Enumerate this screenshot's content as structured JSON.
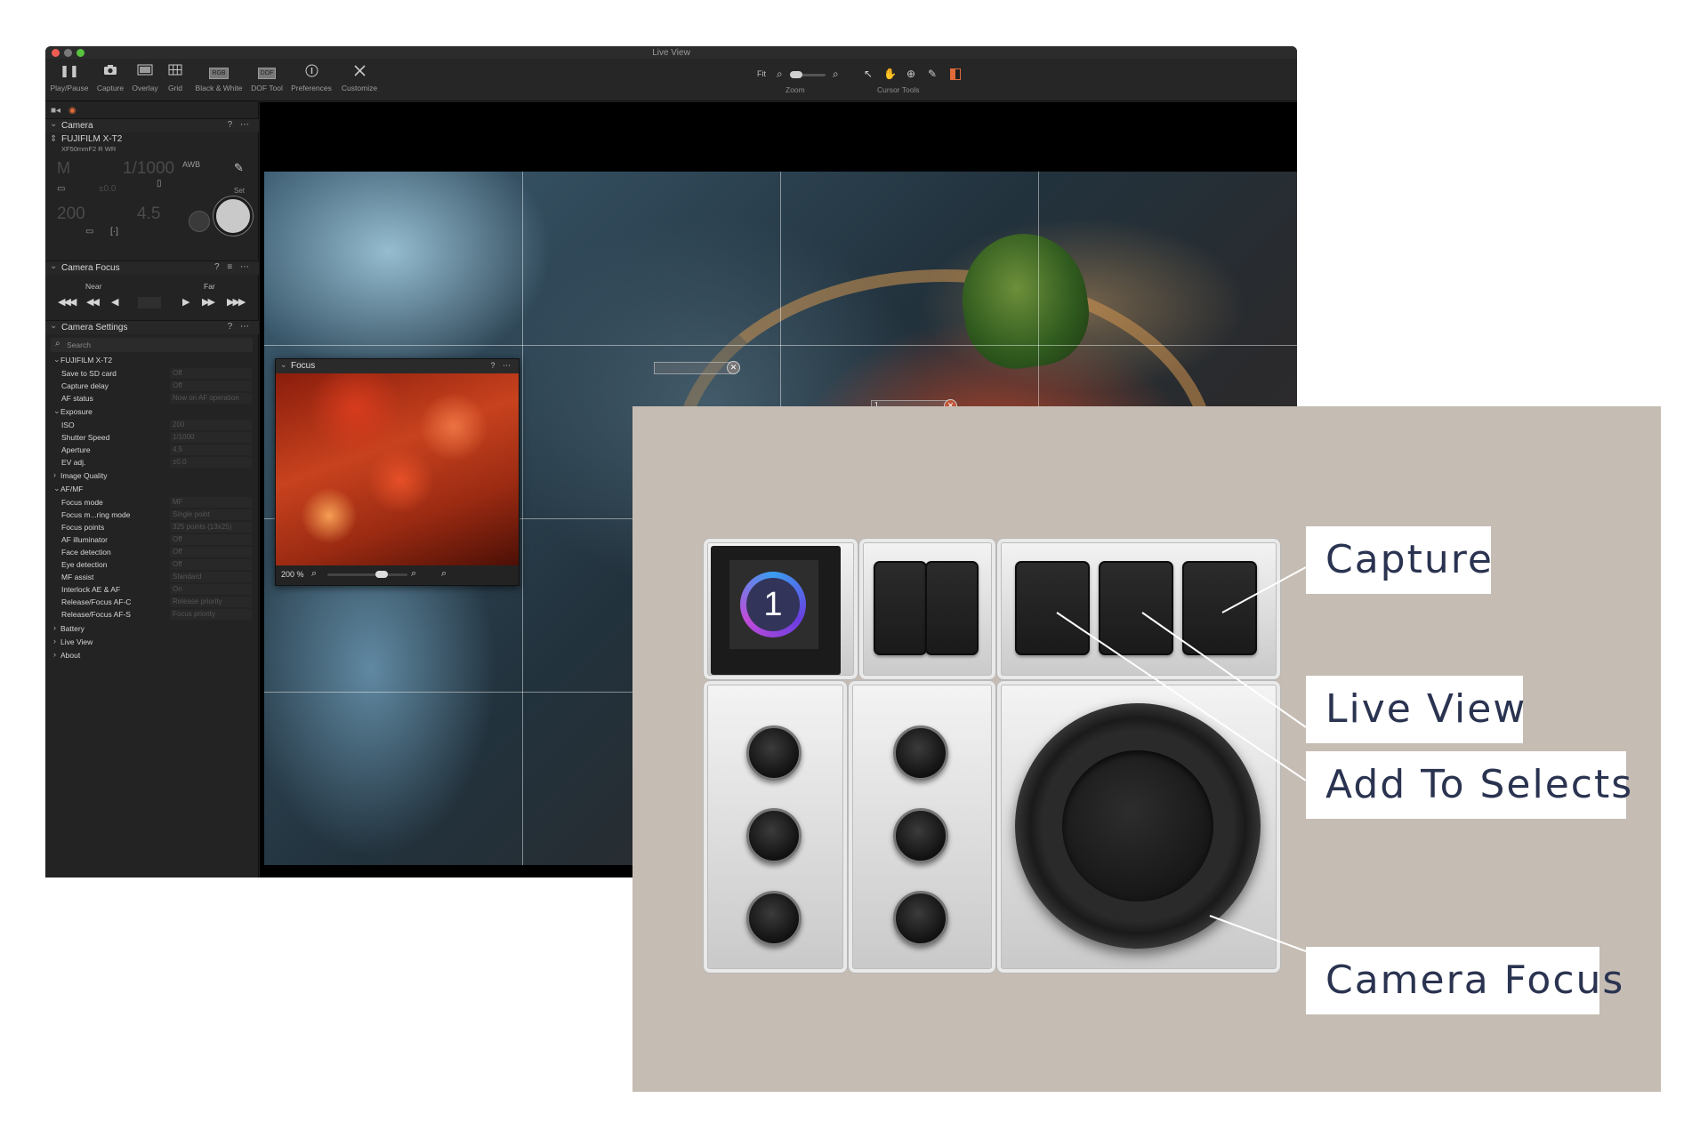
{
  "window": {
    "title": "Live View"
  },
  "toolbar": {
    "play_pause": "Play/Pause",
    "capture": "Capture",
    "overlay": "Overlay",
    "grid": "Grid",
    "black_white": "Black & White",
    "black_white_badge": "RGB",
    "dof_tool": "DOF Tool",
    "dof_badge": "DOF",
    "preferences": "Preferences",
    "customize": "Customize",
    "zoom_fit": "Fit",
    "zoom_label": "Zoom",
    "cursor_tools_label": "Cursor Tools"
  },
  "camera_panel": {
    "title": "Camera",
    "tools": "? ⋯",
    "model": "FUJIFILM X-T2",
    "lens": "XF50mmF2 R WR",
    "mode": "M",
    "shutter": "1/1000",
    "white_balance": "AWB",
    "exposure_comp": "±0.0",
    "iso": "200",
    "aperture": "4.5",
    "set_label": "Set"
  },
  "focus_panel": {
    "title": "Camera Focus",
    "tools": "? ≡ ⋯",
    "near": "Near",
    "far": "Far"
  },
  "settings_panel": {
    "title": "Camera Settings",
    "tools": "? ⋯",
    "search_placeholder": "Search",
    "camera_group": "FUJIFILM X-T2",
    "rows_top": [
      {
        "label": "Save to SD card",
        "value": "Off"
      },
      {
        "label": "Capture delay",
        "value": "Off"
      },
      {
        "label": "AF status",
        "value": "Now on AF operation"
      }
    ],
    "exposure_group": "Exposure",
    "rows_exposure": [
      {
        "label": "ISO",
        "value": "200"
      },
      {
        "label": "Shutter Speed",
        "value": "1/1000"
      },
      {
        "label": "Aperture",
        "value": "4.5"
      },
      {
        "label": "EV adj.",
        "value": "±0.0"
      }
    ],
    "image_quality_group": "Image Quality",
    "afmf_group": "AF/MF",
    "rows_af": [
      {
        "label": "Focus mode",
        "value": "MF"
      },
      {
        "label": "Focus m...ring mode",
        "value": "Single point"
      },
      {
        "label": "Focus points",
        "value": "325 points (13x25)"
      },
      {
        "label": "AF illuminator",
        "value": "Off"
      },
      {
        "label": "Face detection",
        "value": "Off"
      },
      {
        "label": "Eye detection",
        "value": "Off"
      },
      {
        "label": "MF assist",
        "value": "Standard"
      },
      {
        "label": "Interlock AE & AF",
        "value": "On"
      },
      {
        "label": "Release/Focus AF-C",
        "value": "Release priority"
      },
      {
        "label": "Release/Focus AF-S",
        "value": "Focus priority"
      }
    ],
    "battery_group": "Battery",
    "live_view_group": "Live View",
    "about_group": "About"
  },
  "viewer": {
    "af_point_value": "1"
  },
  "focus_window": {
    "title": "Focus",
    "tools": "? ⋯",
    "zoom": "200 %"
  },
  "device": {
    "logo_text": "1"
  },
  "callouts": {
    "capture": "Capture",
    "live_view": "Live View",
    "add_to_selects": "Add To Selects",
    "camera_focus": "Camera Focus"
  },
  "colors": {
    "accent": "#e06a3a",
    "callout_text": "#2a3350",
    "overlay_bg": "#c5bcb3"
  }
}
